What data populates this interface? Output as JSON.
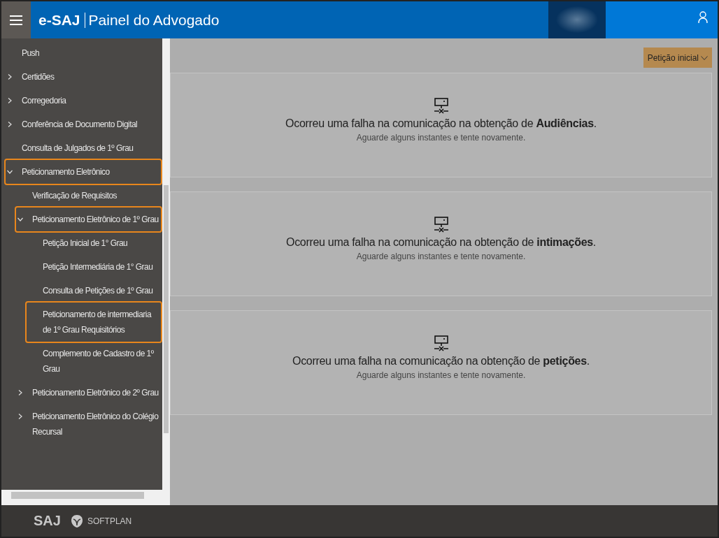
{
  "header": {
    "brand": "e-SAJ",
    "title": "Painel do Advogado"
  },
  "menu": [
    {
      "label": "Push",
      "kind": "link",
      "highlighted": false
    },
    {
      "label": "Certidões",
      "kind": "group",
      "expanded": false,
      "highlighted": false
    },
    {
      "label": "Corregedoria",
      "kind": "group",
      "expanded": false,
      "highlighted": false
    },
    {
      "label": "Conferência de Documento Digital",
      "kind": "group",
      "expanded": false,
      "highlighted": false
    },
    {
      "label": "Consulta de Julgados de 1º Grau",
      "kind": "link",
      "highlighted": false
    },
    {
      "label": "Peticionamento Eletrônico",
      "kind": "group",
      "expanded": true,
      "highlighted": true,
      "children": [
        {
          "label": "Verificação de Requisitos",
          "kind": "link",
          "highlighted": false
        },
        {
          "label": "Peticionamento Eletrônico de 1º Grau",
          "kind": "group",
          "expanded": true,
          "highlighted": true,
          "children": [
            {
              "label": "Petição Inicial de 1° Grau",
              "kind": "link",
              "highlighted": false
            },
            {
              "label": "Petição Intermediária de 1° Grau",
              "kind": "link",
              "highlighted": false
            },
            {
              "label": "Consulta de Petições de 1º Grau",
              "kind": "link",
              "highlighted": false
            },
            {
              "label": "Peticionamento de intermediaria de 1º Grau Requisitórios",
              "kind": "link",
              "highlighted": true
            },
            {
              "label": "Complemento de Cadastro de 1º Grau",
              "kind": "link",
              "highlighted": false
            }
          ]
        },
        {
          "label": "Peticionamento Eletrônico de 2º Grau",
          "kind": "group",
          "expanded": false,
          "highlighted": false
        },
        {
          "label": "Peticionamento Eletrônico do Colégio Recursal",
          "kind": "group",
          "expanded": false,
          "highlighted": false
        }
      ]
    }
  ],
  "action_button": "Petição inicial",
  "panels": [
    {
      "message": "Ocorreu uma falha na comunicação na obtenção de **Audiências**.",
      "hint": "Aguarde alguns instantes e tente novamente."
    },
    {
      "message": "Ocorreu uma falha na comunicação na obtenção de **intimações**.",
      "hint": "Aguarde alguns instantes e tente novamente."
    },
    {
      "message": "Ocorreu uma falha na comunicação na obtenção de **petições**.",
      "hint": "Aguarde alguns instantes e tente novamente."
    }
  ],
  "footer": {
    "logo_1": "SAJ",
    "logo_2": "SOFTPLAN"
  }
}
